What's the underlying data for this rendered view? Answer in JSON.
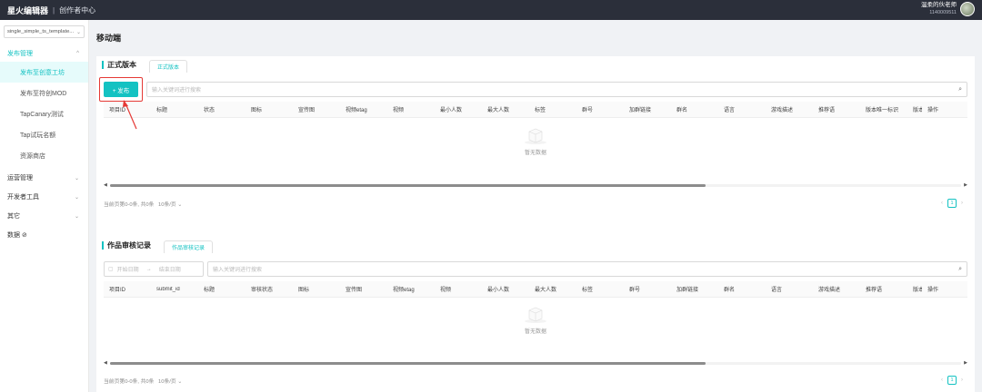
{
  "topbar": {
    "brand": "星火编辑器",
    "separator": "|",
    "subtitle": "创作者中心",
    "user_name": "温柔的伙老师",
    "user_id": "1140009511"
  },
  "sidebar": {
    "project_select": "single_simple_ts_template...",
    "groups": [
      {
        "label": "发布管理"
      },
      {
        "label": "运营管理"
      },
      {
        "label": "开发者工具"
      },
      {
        "label": "其它"
      },
      {
        "label": "数据 ⊘"
      }
    ],
    "publish_items": [
      {
        "label": "发布至创意工坊"
      },
      {
        "label": "发布至符创MOD"
      },
      {
        "label": "TapCanary测试"
      },
      {
        "label": "Tap试玩名额"
      },
      {
        "label": "资源商店"
      }
    ]
  },
  "main": {
    "page_title": "移动端",
    "section1": {
      "tab_title": "正式版本",
      "tab_sub": "正式版本",
      "publish_button": "+ 发布",
      "search_placeholder": "输入关键词进行搜索",
      "columns": [
        "项目ID",
        "标题",
        "状态",
        "图标",
        "宣传图",
        "视频etag",
        "视频",
        "最小人数",
        "最大人数",
        "标签",
        "群号",
        "加群链接",
        "群名",
        "语言",
        "游戏描述",
        "推荐语",
        "版本唯一标识",
        "版本",
        "操作"
      ],
      "empty_text": "暂无数据",
      "footer_text": "当前页第0-0条, 共0条",
      "page_size": "10条/页",
      "current_page": "1",
      "scroll_fraction": 0.7
    },
    "section2": {
      "tab_title": "作品审核记录",
      "tab_sub": "作品审核记录",
      "date_start": "开始日期",
      "date_end": "结束日期",
      "search_placeholder": "输入关键词进行搜索",
      "columns": [
        "项目ID",
        "submit_id",
        "标题",
        "审核状态",
        "图标",
        "宣传图",
        "视频etag",
        "视频",
        "最小人数",
        "最大人数",
        "标签",
        "群号",
        "加群链接",
        "群名",
        "语言",
        "游戏描述",
        "推荐语",
        "版本",
        "操作"
      ],
      "empty_text": "暂无数据",
      "footer_text": "当前页第0-0条, 共0条",
      "page_size": "10条/页",
      "current_page": "1",
      "scroll_fraction": 0.7
    }
  }
}
